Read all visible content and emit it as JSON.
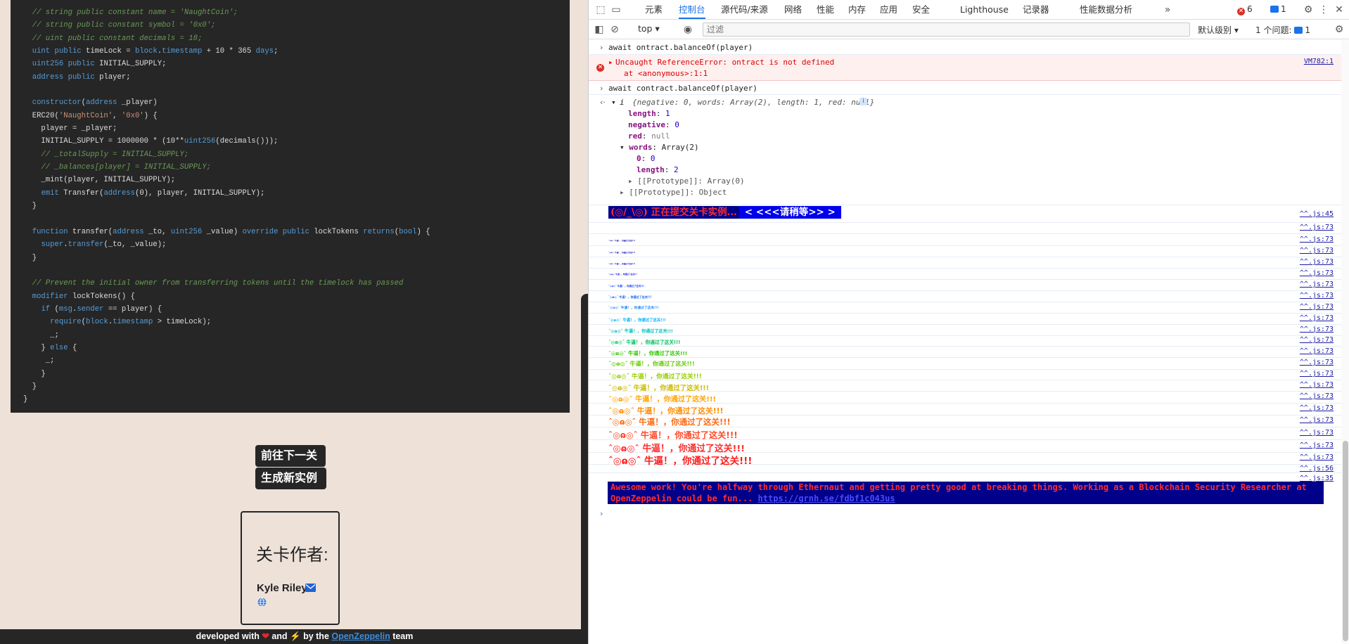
{
  "code": {
    "lines": [
      [
        {
          "c": "  "
        },
        {
          "t": "comment",
          "c": "// string public constant name = 'NaughtCoin';"
        }
      ],
      [
        {
          "c": "  "
        },
        {
          "t": "comment",
          "c": "// string public constant symbol = '0x0';"
        }
      ],
      [
        {
          "c": "  "
        },
        {
          "t": "comment",
          "c": "// uint public constant decimals = 18;"
        }
      ],
      [
        {
          "c": "  "
        },
        {
          "t": "kw",
          "c": "uint"
        },
        {
          "c": " "
        },
        {
          "t": "kw",
          "c": "public"
        },
        {
          "c": " timeLock = "
        },
        {
          "t": "kw",
          "c": "block"
        },
        {
          "c": "."
        },
        {
          "t": "kw",
          "c": "timestamp"
        },
        {
          "c": " + 10 * 365 "
        },
        {
          "t": "kw",
          "c": "days"
        },
        {
          "c": ";"
        }
      ],
      [
        {
          "c": "  "
        },
        {
          "t": "kw",
          "c": "uint256"
        },
        {
          "c": " "
        },
        {
          "t": "kw",
          "c": "public"
        },
        {
          "c": " INITIAL_SUPPLY;"
        }
      ],
      [
        {
          "c": "  "
        },
        {
          "t": "kw",
          "c": "address"
        },
        {
          "c": " "
        },
        {
          "t": "kw",
          "c": "public"
        },
        {
          "c": " player;"
        }
      ],
      [
        {
          "c": ""
        }
      ],
      [
        {
          "c": "  "
        },
        {
          "t": "kw",
          "c": "constructor"
        },
        {
          "c": "("
        },
        {
          "t": "kw",
          "c": "address"
        },
        {
          "c": " _player)"
        }
      ],
      [
        {
          "c": "  ERC20("
        },
        {
          "t": "str",
          "c": "'NaughtCoin'"
        },
        {
          "c": ", "
        },
        {
          "t": "str",
          "c": "'0x0'"
        },
        {
          "c": ") {"
        }
      ],
      [
        {
          "c": "    player = _player;"
        }
      ],
      [
        {
          "c": "    INITIAL_SUPPLY = 1000000 * (10**"
        },
        {
          "t": "kw",
          "c": "uint256"
        },
        {
          "c": "(decimals()));"
        }
      ],
      [
        {
          "c": "    "
        },
        {
          "t": "comment",
          "c": "// _totalSupply = INITIAL_SUPPLY;"
        }
      ],
      [
        {
          "c": "    "
        },
        {
          "t": "comment",
          "c": "// _balances[player] = INITIAL_SUPPLY;"
        }
      ],
      [
        {
          "c": "    _mint(player, INITIAL_SUPPLY);"
        }
      ],
      [
        {
          "c": "    "
        },
        {
          "t": "kw",
          "c": "emit"
        },
        {
          "c": " Transfer("
        },
        {
          "t": "kw",
          "c": "address"
        },
        {
          "c": "(0), player, INITIAL_SUPPLY);"
        }
      ],
      [
        {
          "c": "  }"
        }
      ],
      [
        {
          "c": ""
        }
      ],
      [
        {
          "c": "  "
        },
        {
          "t": "kw",
          "c": "function"
        },
        {
          "c": " transfer("
        },
        {
          "t": "kw",
          "c": "address"
        },
        {
          "c": " _to, "
        },
        {
          "t": "kw",
          "c": "uint256"
        },
        {
          "c": " _value) "
        },
        {
          "t": "kw",
          "c": "override"
        },
        {
          "c": " "
        },
        {
          "t": "kw",
          "c": "public"
        },
        {
          "c": " lockTokens "
        },
        {
          "t": "kw",
          "c": "returns"
        },
        {
          "c": "("
        },
        {
          "t": "kw",
          "c": "bool"
        },
        {
          "c": ") {"
        }
      ],
      [
        {
          "c": "    "
        },
        {
          "t": "kw",
          "c": "super"
        },
        {
          "c": "."
        },
        {
          "t": "kw",
          "c": "transfer"
        },
        {
          "c": "(_to, _value);"
        }
      ],
      [
        {
          "c": "  }"
        }
      ],
      [
        {
          "c": ""
        }
      ],
      [
        {
          "c": "  "
        },
        {
          "t": "comment",
          "c": "// Prevent the initial owner from transferring tokens until the timelock has passed"
        }
      ],
      [
        {
          "c": "  "
        },
        {
          "t": "kw",
          "c": "modifier"
        },
        {
          "c": " lockTokens() {"
        }
      ],
      [
        {
          "c": "    "
        },
        {
          "t": "kw",
          "c": "if"
        },
        {
          "c": " ("
        },
        {
          "t": "kw",
          "c": "msg"
        },
        {
          "c": "."
        },
        {
          "t": "kw",
          "c": "sender"
        },
        {
          "c": " == player) {"
        }
      ],
      [
        {
          "c": "      "
        },
        {
          "t": "kw",
          "c": "require"
        },
        {
          "c": "("
        },
        {
          "t": "kw",
          "c": "block"
        },
        {
          "c": "."
        },
        {
          "t": "kw",
          "c": "timestamp"
        },
        {
          "c": " > timeLock);"
        }
      ],
      [
        {
          "c": "      _;"
        }
      ],
      [
        {
          "c": "    } "
        },
        {
          "t": "kw",
          "c": "else"
        },
        {
          "c": " {"
        }
      ],
      [
        {
          "c": "     _;"
        }
      ],
      [
        {
          "c": "    }"
        }
      ],
      [
        {
          "c": "  }"
        }
      ],
      [
        {
          "c": "}"
        }
      ]
    ]
  },
  "left": {
    "next_level_btn": "前往下一关",
    "new_instance_btn": "生成新实例",
    "author_heading": "关卡作者:",
    "author_name": "Kyle Riley",
    "footer": {
      "prefix": "developed with ",
      "heart": "❤",
      "middle": " and ",
      "bolt": "⚡",
      "by": " by the ",
      "link": "OpenZeppelin",
      "suffix": " team"
    }
  },
  "devtools": {
    "tabs": [
      "元素",
      "控制台",
      "源代码/来源",
      "网络",
      "性能",
      "内存",
      "应用",
      "安全",
      "Lighthouse",
      "记录器",
      "性能数据分析"
    ],
    "active_tab": "控制台",
    "errors_count": "6",
    "messages_count": "1",
    "context": "top",
    "filter_placeholder": "过滤",
    "levels": "默认级别",
    "issues": "1 个问题:",
    "issues_count": "1"
  },
  "console": {
    "cmd1": "await ontract.balanceOf(player)",
    "error_msg": "Uncaught ReferenceError: ontract is not defined",
    "error_loc": "at <anonymous>:1:1",
    "error_src": "VM782:1",
    "cmd2": "await contract.balanceOf(player)",
    "obj_summary_i": "i",
    "obj_summary": "{negative: 0, words: Array(2), length: 1, red: null}",
    "obj_length_key": "length",
    "obj_length_val": "1",
    "obj_negative_key": "negative",
    "obj_negative_val": "0",
    "obj_red_key": "red",
    "obj_red_val": "null",
    "obj_words_key": "words",
    "obj_words_val": "Array(2)",
    "obj_words0_key": "0",
    "obj_words0_val": "0",
    "obj_words_len_key": "length",
    "obj_words_len_val": "2",
    "obj_proto_inner": "[[Prototype]]: Array(0)",
    "obj_proto_outer": "[[Prototype]]: Object",
    "waiting_part1": "(◎/_\\◎) 正在提交关卡实例...",
    "waiting_part2": "< <<<请稍等>> >",
    "waiting_src": "^^.js:45",
    "pass_src": "^^.js:73",
    "pass_msg": "ˆ◎ɷ◎ˆ 牛逼！，你通过了这关!!!",
    "end_src1": "^^.js:56",
    "end_src2": "^^.js:35",
    "final_msg": "Awesome work! You're halfway through Ethernaut and getting pretty good at breaking things. Working as a Blockchain Security Researcher at OpenZeppelin could be fun... ",
    "final_link": "https://grnh.se/fdbf1c043us",
    "pass_colors": [
      "#0000a0",
      "#0000a0",
      "#0000b8",
      "#0000d8",
      "#0000ff",
      "#0b3fff",
      "#1463ff",
      "#1a8cff",
      "#00b0ff",
      "#00c0c0",
      "#00c060",
      "#32c800",
      "#66cc00",
      "#99cc00",
      "#ccbb00",
      "#ffa500",
      "#ff8c00",
      "#ff6a10",
      "#ff4a2a",
      "#ff2d2d",
      "#ff1a1a"
    ]
  }
}
